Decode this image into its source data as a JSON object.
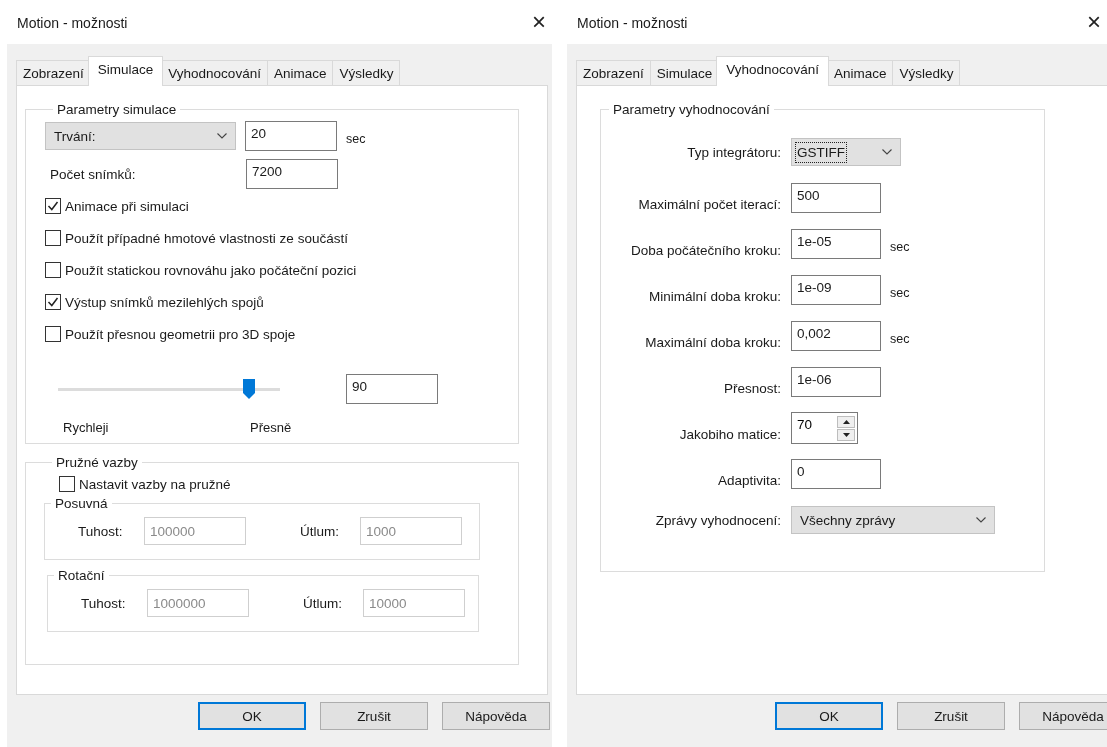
{
  "dialogs": [
    {
      "title": "Motion - možnosti",
      "close": "×",
      "tabs": [
        {
          "label": "Zobrazení",
          "selected": false
        },
        {
          "label": "Simulace",
          "selected": true
        },
        {
          "label": "Vyhodnocování",
          "selected": false
        },
        {
          "label": "Animace",
          "selected": false
        },
        {
          "label": "Výsledky",
          "selected": false
        }
      ],
      "panel": {
        "kind": "simulation",
        "simulation": {
          "title": "Parametry simulace",
          "duration": {
            "option": "Trvání:",
            "value": "20",
            "unit": "sec"
          },
          "frames": {
            "label": "Počet snímků:",
            "value": "7200"
          },
          "options": [
            {
              "label": "Animace při simulaci",
              "checked": true
            },
            {
              "label": "Použít případné hmotové vlastnosti ze součástí",
              "checked": false
            },
            {
              "label": "Použít statickou rovnováhu jako počáteční pozici",
              "checked": false
            },
            {
              "label": "Výstup snímků mezilehlých spojů",
              "checked": true
            },
            {
              "label": "Použít přesnou geometrii pro 3D spoje",
              "checked": false
            }
          ],
          "accuracy": {
            "level": 0.86,
            "value": "90",
            "min_label": "Rychleji",
            "max_label": "Přesně"
          }
        },
        "springs": {
          "title": "Pružné vazby",
          "checkbox": {
            "label": "Nastavit vazby na pružné",
            "checked": false
          },
          "subgroups": [
            {
              "title": "Posuvná",
              "fields": [
                {
                  "label": "Tuhost:",
                  "value": "100000",
                  "disabled": true
                },
                {
                  "label": "Útlum:",
                  "value": "1000",
                  "disabled": true
                }
              ]
            },
            {
              "title": "Rotační",
              "fields": [
                {
                  "label": "Tuhost:",
                  "value": "1000000",
                  "disabled": true
                },
                {
                  "label": "Útlum:",
                  "value": "10000",
                  "disabled": true
                }
              ]
            }
          ]
        }
      },
      "buttons": [
        {
          "label": "OK",
          "default": true
        },
        {
          "label": "Zrušit",
          "default": false
        },
        {
          "label": "Nápověda",
          "default": false
        }
      ]
    },
    {
      "title": "Motion - možnosti",
      "close": "×",
      "tabs": [
        {
          "label": "Zobrazení",
          "selected": false
        },
        {
          "label": "Simulace",
          "selected": false
        },
        {
          "label": "Vyhodnocování",
          "selected": true
        },
        {
          "label": "Animace",
          "selected": false
        },
        {
          "label": "Výsledky",
          "selected": false
        }
      ],
      "panel": {
        "kind": "evaluation",
        "evaluation": {
          "title": "Parametry vyhodnocování",
          "rows": [
            {
              "kind": "dropdown",
              "label": "Typ integrátoru:",
              "value": "GSTIFF",
              "focused": true
            },
            {
              "kind": "input",
              "label": "Maximální počet iterací:",
              "value": "500"
            },
            {
              "kind": "input",
              "label": "Doba počátečního kroku:",
              "value": "1e-05",
              "unit": "sec"
            },
            {
              "kind": "input",
              "label": "Minimální doba kroku:",
              "value": "1e-09",
              "unit": "sec"
            },
            {
              "kind": "input",
              "label": "Maximální doba kroku:",
              "value": "0,002",
              "unit": "sec"
            },
            {
              "kind": "input",
              "label": "Přesnost:",
              "value": "1e-06"
            },
            {
              "kind": "spin",
              "label": "Jakobiho matice:",
              "value": "70"
            },
            {
              "kind": "input",
              "label": "Adaptivita:",
              "value": "0"
            },
            {
              "kind": "dropdown",
              "label": "Zprávy vyhodnocení:",
              "value": "Všechny zprávy",
              "focused": false
            }
          ]
        }
      },
      "buttons": [
        {
          "label": "OK",
          "default": true
        },
        {
          "label": "Zrušit",
          "default": false
        },
        {
          "label": "Nápověda",
          "default": false
        }
      ]
    }
  ]
}
